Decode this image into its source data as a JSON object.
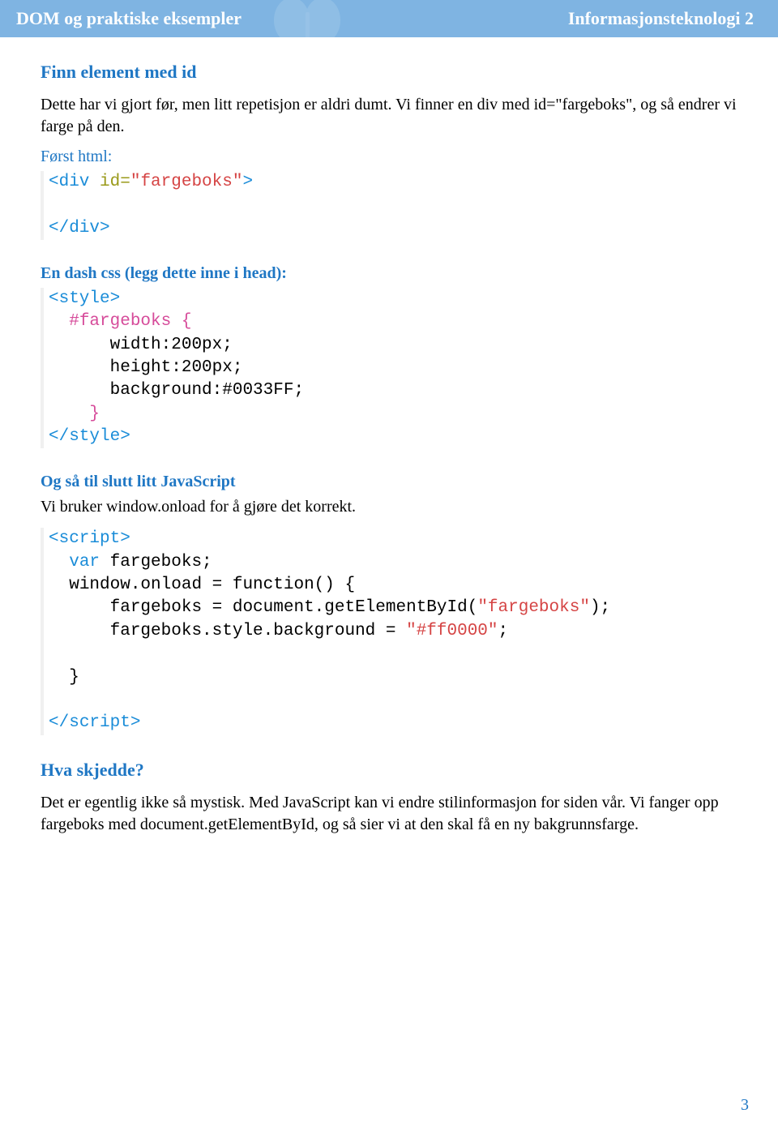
{
  "header": {
    "left": "DOM og praktiske eksempler",
    "right": "Informasjonsteknologi 2"
  },
  "sections": {
    "h1": "Finn element med id",
    "p1": "Dette har vi gjort før, men litt repetisjon er aldri dumt. Vi finner en div med id=\"fargeboks\", og så endrer vi farge på den.",
    "sub_html": "Først html:",
    "sub_css": "En dash css (legg dette inne i head):",
    "sub_js": "Og så til slutt litt JavaScript",
    "p2": "Vi bruker window.onload for å gjøre det korrekt.",
    "h2": "Hva skjedde?",
    "p3": "Det er egentlig ikke så mystisk. Med JavaScript kan vi endre stilinformasjon for siden vår. Vi fanger opp fargeboks med document.getElementById, og så sier vi at den skal få en ny bakgrunnsfarge."
  },
  "code": {
    "html": {
      "div_open": "<div",
      "id_attr": " id=",
      "id_val": "\"fargeboks\"",
      "close_gt": ">",
      "div_close": "</div>"
    },
    "css": {
      "style_open": "<style>",
      "selector": "#fargeboks {",
      "width": "width:200px;",
      "height": "height:200px;",
      "background": "background:#0033FF;",
      "brace_close": "}",
      "style_close": "</style>"
    },
    "js": {
      "script_open": "<script>",
      "var_decl_kw": "var",
      "var_decl_rest": " fargeboks;",
      "onload_line": "window.onload = function() {",
      "get_line_a": "    fargeboks = document.getElementById(",
      "get_line_str": "\"fargeboks\"",
      "get_line_b": ");",
      "bg_line_a": "    fargeboks.style.background = ",
      "bg_line_str": "\"#ff0000\"",
      "bg_line_b": ";",
      "brace_close": "}",
      "script_close_a": "</",
      "script_close_b": "script>"
    }
  },
  "page_number": "3"
}
